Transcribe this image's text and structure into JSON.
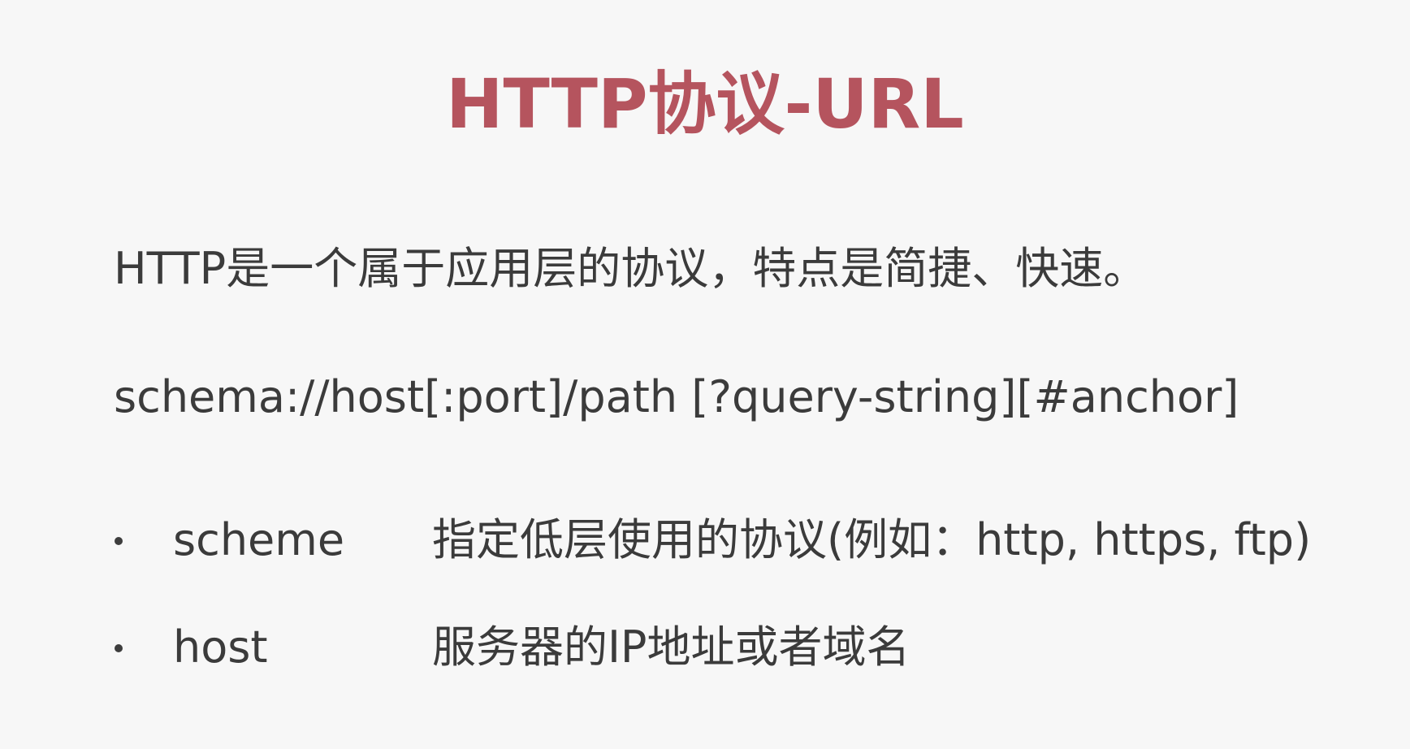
{
  "slide": {
    "title": "HTTP协议-URL",
    "description": "HTTP是一个属于应用层的协议，特点是简捷、快速。",
    "syntax": "schema://host[:port]/path [?query-string][#anchor]",
    "items": [
      {
        "term": "scheme",
        "desc": "指定低层使用的协议(例如：http, https, ftp)"
      },
      {
        "term": "host",
        "desc": "服务器的IP地址或者域名"
      }
    ]
  },
  "colors": {
    "title": "#b5545e",
    "text": "#3b3b3b",
    "background": "#f7f7f7"
  }
}
